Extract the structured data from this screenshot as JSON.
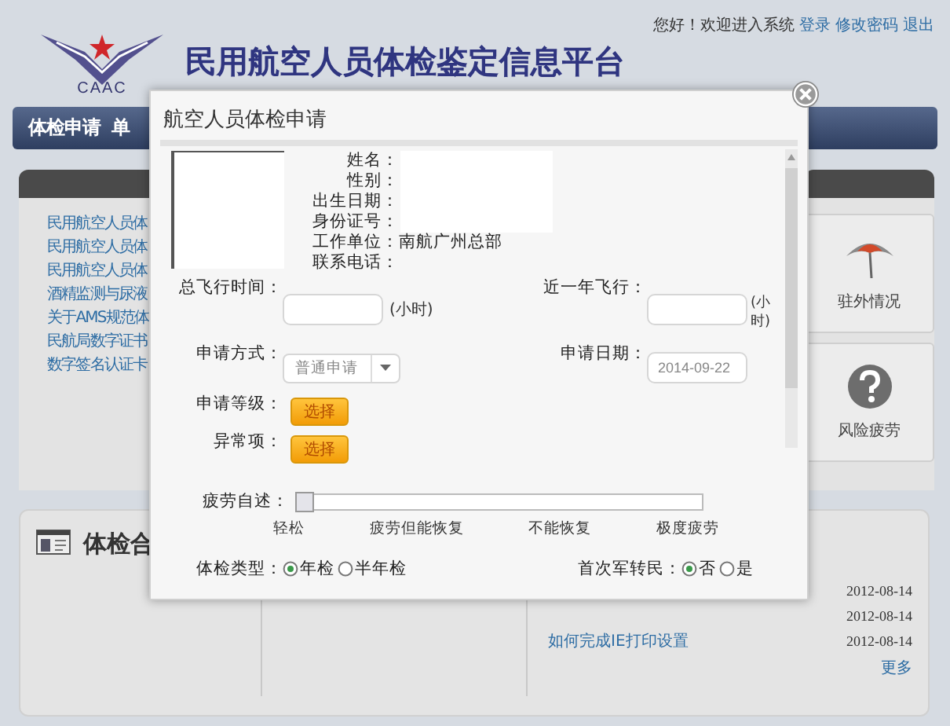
{
  "header": {
    "logo_text": "CAAC",
    "title": "民用航空人员体检鉴定信息平台",
    "greeting": "您好！欢迎进入系统",
    "links": [
      "登录",
      "修改密码",
      "退出"
    ]
  },
  "nav": {
    "items": [
      "体检申请",
      "单"
    ]
  },
  "notice_links": [
    "民用航空人员体",
    "民用航空人员体",
    "民用航空人员体",
    "酒精监测与尿液",
    "关于AMS规范体",
    "民航局数字证书",
    "数字签名认证卡"
  ],
  "tiles": [
    {
      "kind": "umbrella",
      "label": "驻外情况"
    },
    {
      "kind": "question",
      "label": "风险疲劳"
    }
  ],
  "bottom": {
    "title": "体检合",
    "news": [
      {
        "date": "2012-08-14"
      },
      {
        "date": "2012-08-14"
      },
      {
        "title": "如何完成IE打印设置",
        "date": "2012-08-14"
      }
    ],
    "more": "更多"
  },
  "dialog": {
    "title": "航空人员体检申请",
    "info": [
      {
        "label": "姓名："
      },
      {
        "label": "性别："
      },
      {
        "label": "出生日期："
      },
      {
        "label": "身份证号："
      },
      {
        "label": "工作单位：",
        "value": "南航广州总部"
      },
      {
        "label": "联系电话："
      }
    ],
    "total_hours": {
      "label": "总飞行时间：",
      "unit": "(小时)"
    },
    "recent_hours": {
      "label": "近一年飞行：",
      "unit": "(小时)"
    },
    "apply_method": {
      "label": "申请方式：",
      "value": "普通申请"
    },
    "apply_date": {
      "label": "申请日期：",
      "value": "2014-09-22"
    },
    "apply_level": {
      "label": "申请等级：",
      "button": "选择"
    },
    "abnormal": {
      "label": "异常项：",
      "button": "选择"
    },
    "fatigue": {
      "label": "疲劳自述：",
      "level": 0,
      "ticks": [
        "轻松",
        "疲劳但能恢复",
        "不能恢复",
        "极度疲劳"
      ]
    },
    "exam_type": {
      "label": "体检类型：",
      "options": [
        {
          "label": "年检",
          "selected": true
        },
        {
          "label": "半年检",
          "selected": false
        }
      ]
    },
    "first_transfer": {
      "label": "首次军转民：",
      "options": [
        {
          "label": "否",
          "selected": true
        },
        {
          "label": "是",
          "selected": false
        }
      ]
    }
  }
}
